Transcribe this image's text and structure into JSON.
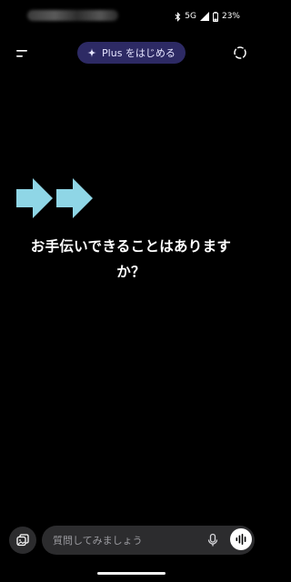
{
  "status_bar": {
    "network": "5G",
    "battery": "23%",
    "icons": [
      "bluetooth-icon",
      "signal-icon",
      "battery-icon"
    ]
  },
  "header": {
    "upgrade_label": "Plus をはじめる",
    "icons": [
      "menu-icon",
      "sparkle-icon",
      "temporary-chat-icon"
    ]
  },
  "main": {
    "greeting": "お手伝いできることはありますか？"
  },
  "composer": {
    "placeholder": "質問してみましょう",
    "icons": [
      "attach-icon",
      "mic-icon",
      "voice-mode-icon"
    ]
  },
  "colors": {
    "background": "#000000",
    "pill": "#2d2a64",
    "input_bg": "#2c2c2e",
    "arrow": "#8fd6e6"
  }
}
